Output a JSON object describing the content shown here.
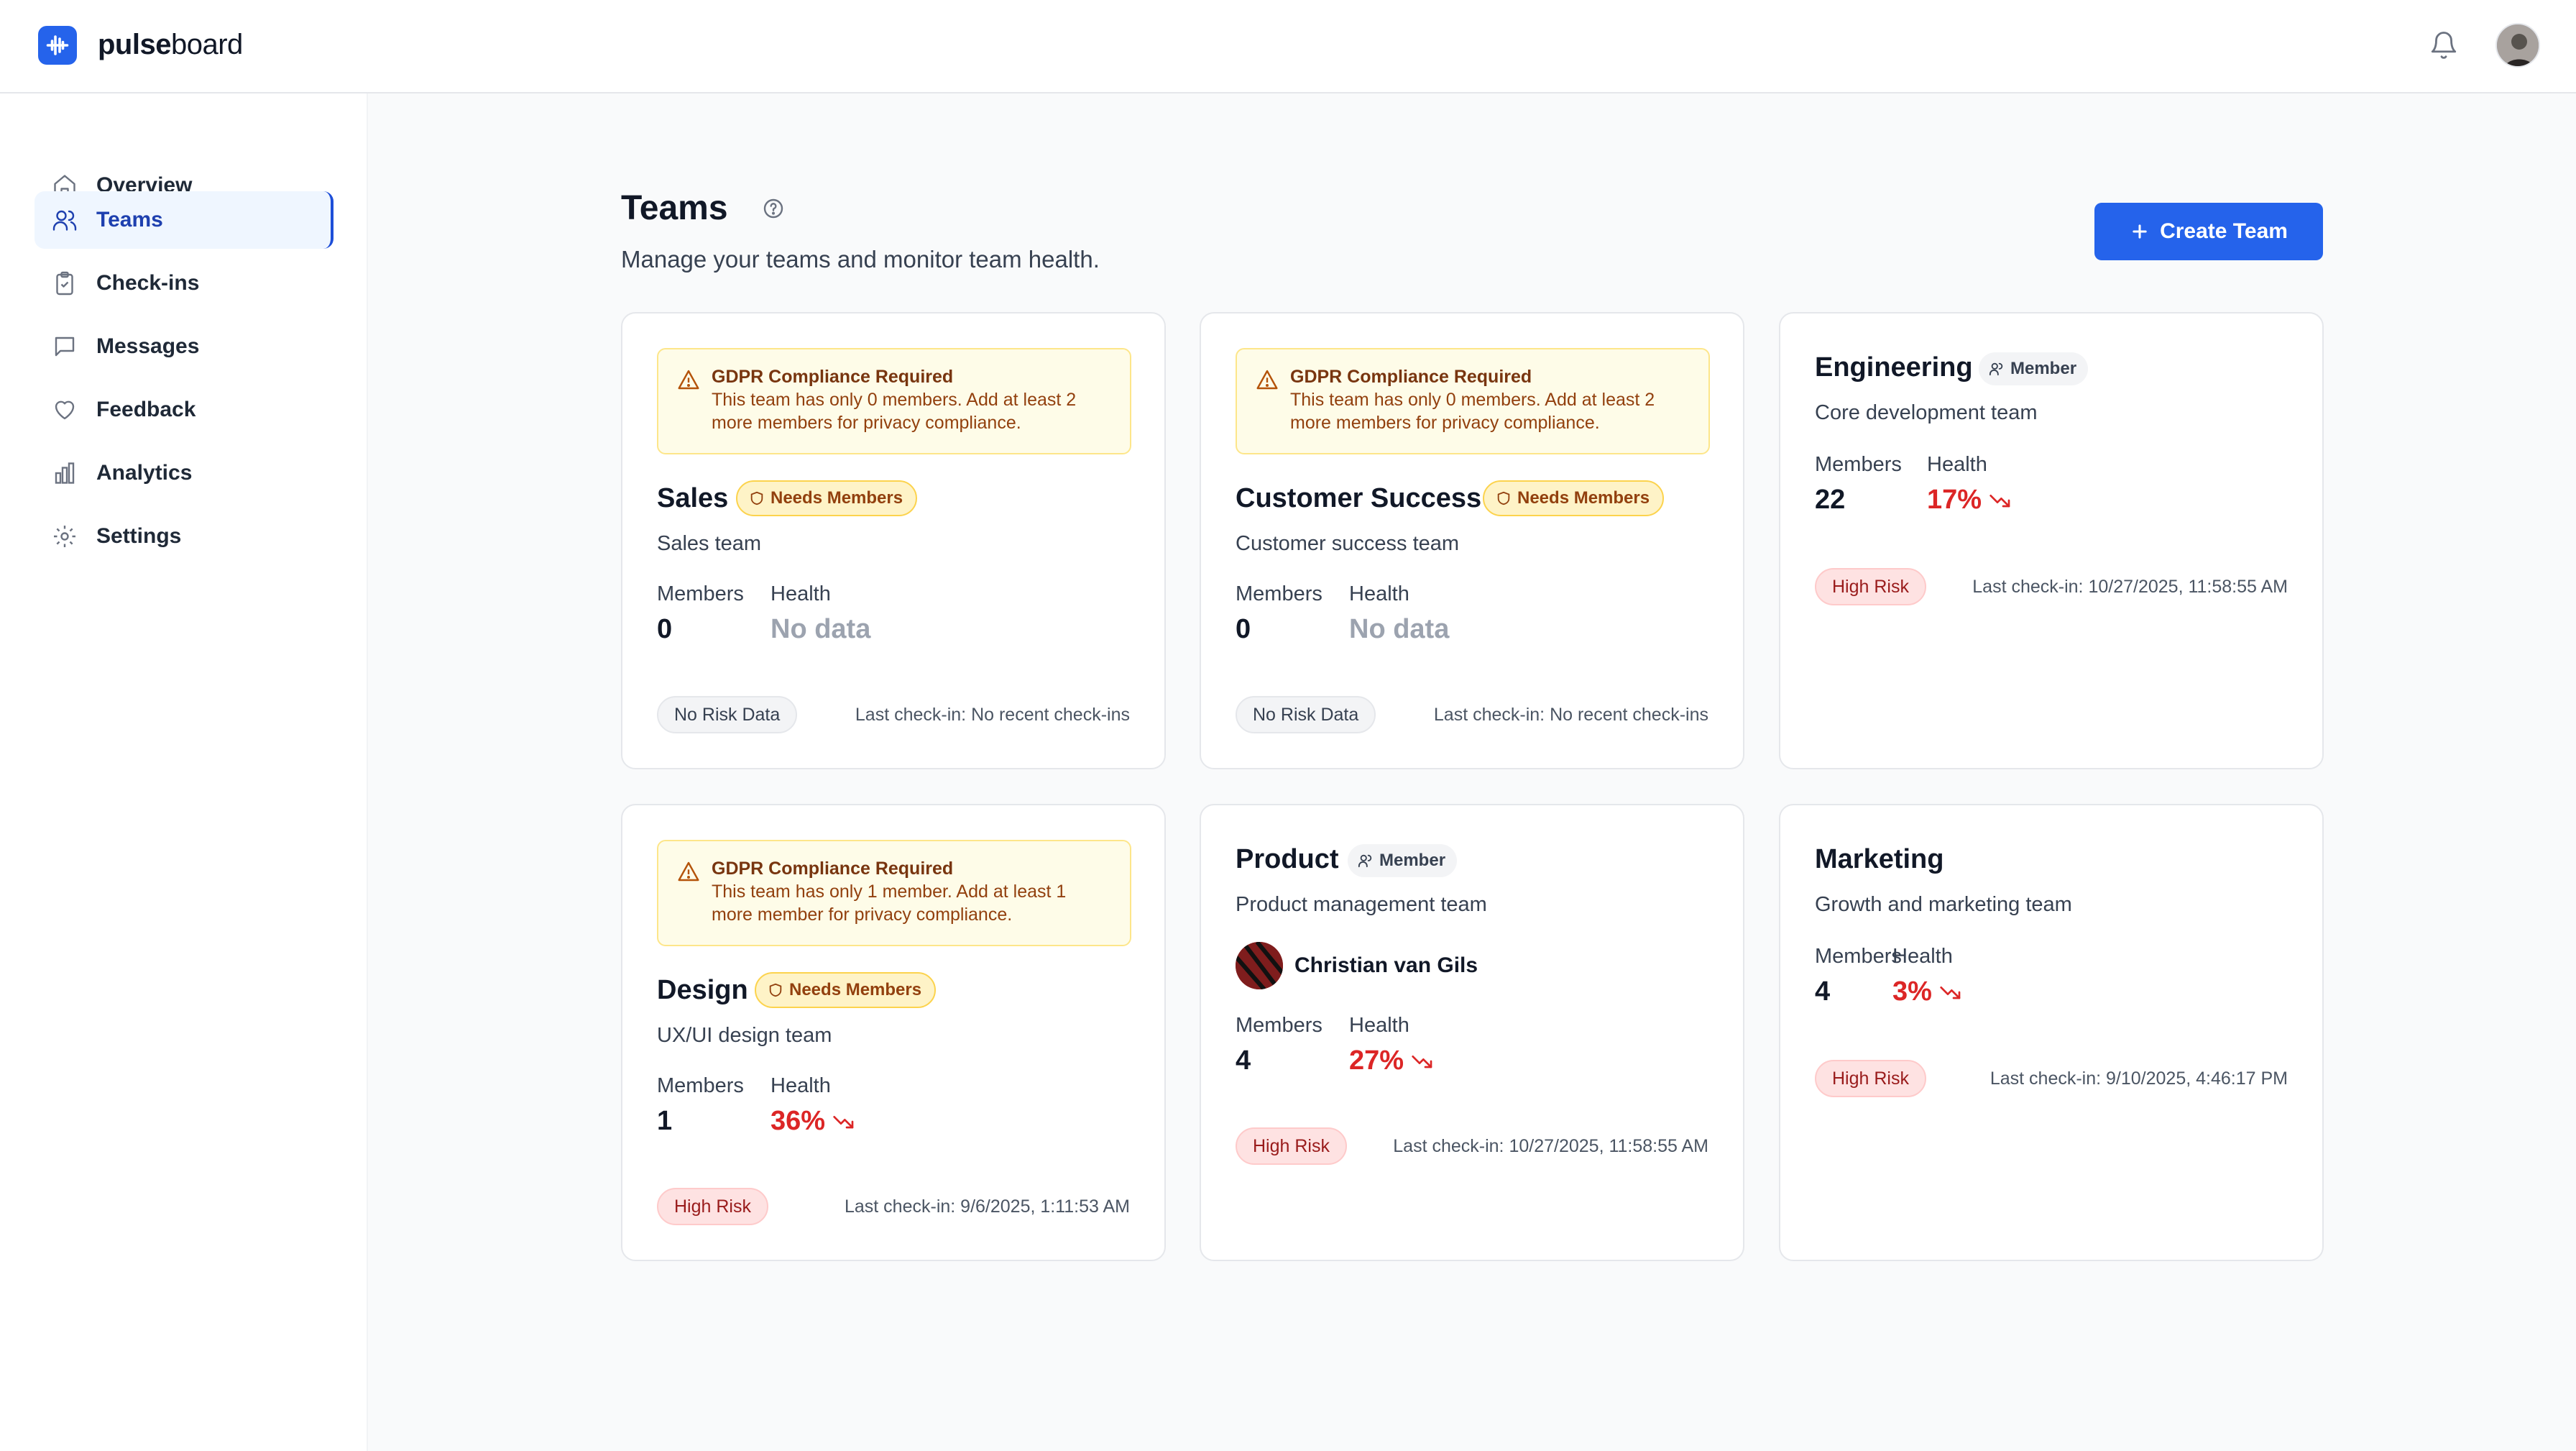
{
  "app": {
    "brand_bold": "pulse",
    "brand_light": "board"
  },
  "sidebar": {
    "items": [
      {
        "label": "Overview",
        "icon": "home-icon"
      },
      {
        "label": "Teams",
        "icon": "users-icon",
        "active": true
      },
      {
        "label": "Check-ins",
        "icon": "clipboard-icon"
      },
      {
        "label": "Messages",
        "icon": "message-icon"
      },
      {
        "label": "Feedback",
        "icon": "heart-icon"
      },
      {
        "label": "Analytics",
        "icon": "bar-chart-icon"
      },
      {
        "label": "Settings",
        "icon": "gear-icon"
      }
    ]
  },
  "page": {
    "title": "Teams",
    "subtitle": "Manage your teams and monitor team health.",
    "create_label": "Create Team"
  },
  "labels": {
    "members": "Members",
    "health": "Health"
  },
  "cards": [
    {
      "alert_title": "GDPR Compliance Required",
      "alert_line1": "This team has only 0 members. Add at least 2",
      "alert_line2": "more members for privacy compliance.",
      "name": "Sales",
      "badge": "Needs Members",
      "description": "Sales team",
      "members": "0",
      "health": "No data",
      "risk": "No Risk Data",
      "checkin": "Last check-in: No recent check-ins"
    },
    {
      "alert_title": "GDPR Compliance Required",
      "alert_line1": "This team has only 0 members. Add at least 2",
      "alert_line2": "more members for privacy compliance.",
      "name": "Customer Success",
      "badge": "Needs Members",
      "description": "Customer success team",
      "members": "0",
      "health": "No data",
      "risk": "No Risk Data",
      "checkin": "Last check-in: No recent check-ins"
    },
    {
      "name": "Engineering",
      "badge": "Member",
      "description": "Core development team",
      "members": "22",
      "health": "17%",
      "risk": "High Risk",
      "checkin": "Last check-in: 10/27/2025, 11:58:55 AM"
    },
    {
      "alert_title": "GDPR Compliance Required",
      "alert_line1": "This team has only 1 member. Add at least 1",
      "alert_line2": "more member for privacy compliance.",
      "name": "Design",
      "badge": "Needs Members",
      "description": "UX/UI design team",
      "members": "1",
      "health": "36%",
      "risk": "High Risk",
      "checkin": "Last check-in: 9/6/2025, 1:11:53 AM"
    },
    {
      "name": "Product",
      "badge": "Member",
      "description": "Product management team",
      "person": "Christian van Gils",
      "members": "4",
      "health": "27%",
      "risk": "High Risk",
      "checkin": "Last check-in: 10/27/2025, 11:58:55 AM"
    },
    {
      "name": "Marketing",
      "description": "Growth and marketing team",
      "members": "4",
      "health": "3%",
      "risk": "High Risk",
      "checkin": "Last check-in: 9/10/2025, 4:46:17 PM"
    }
  ],
  "colors": {
    "accent": "#2563eb",
    "danger": "#dc2626",
    "warning_bg": "#fefce8"
  }
}
